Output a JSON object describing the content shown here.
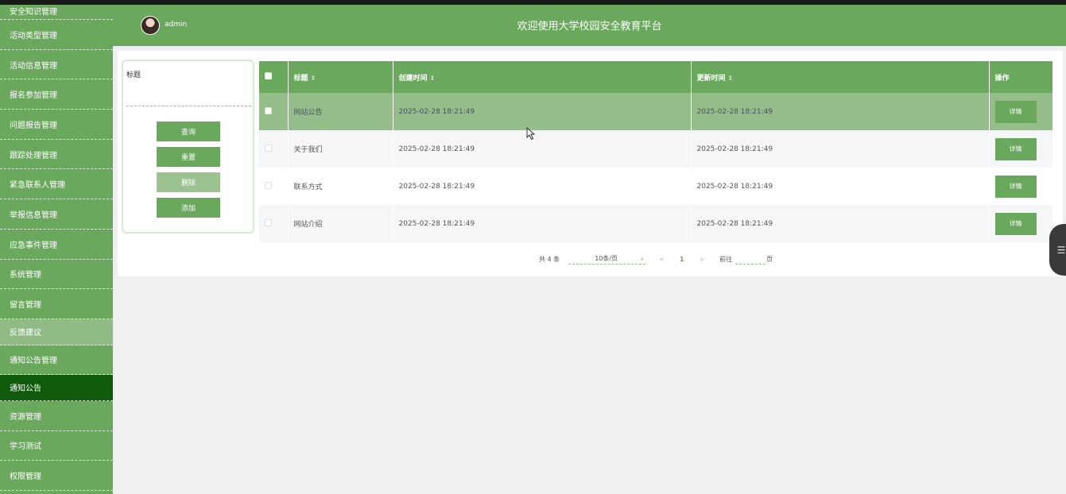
{
  "sidebar": {
    "items": [
      {
        "label": "安全知识管理",
        "state": "partial"
      },
      {
        "label": "活动类型管理",
        "state": ""
      },
      {
        "label": "活动信息管理",
        "state": ""
      },
      {
        "label": "报名参加管理",
        "state": ""
      },
      {
        "label": "问题报告管理",
        "state": ""
      },
      {
        "label": "跟踪处理管理",
        "state": ""
      },
      {
        "label": "紧急联系人管理",
        "state": ""
      },
      {
        "label": "举报信息管理",
        "state": ""
      },
      {
        "label": "应急事件管理",
        "state": ""
      },
      {
        "label": "系统管理",
        "state": ""
      },
      {
        "label": "留言管理",
        "state": ""
      },
      {
        "label": "反馈建议",
        "state": "hover"
      },
      {
        "label": "通知公告管理",
        "state": ""
      },
      {
        "label": "通知公告",
        "state": "active"
      },
      {
        "label": "资源管理",
        "state": ""
      },
      {
        "label": "学习测试",
        "state": ""
      },
      {
        "label": "权限管理",
        "state": ""
      }
    ]
  },
  "header": {
    "username": "admin",
    "title": "欢迎使用大学校园安全教育平台"
  },
  "search": {
    "title_label": "标题",
    "title_value": "",
    "query_label": "查询",
    "reset_label": "重置",
    "delete_label": "删除",
    "add_label": "添加"
  },
  "table": {
    "columns": [
      "标题",
      "创建时间",
      "更新时间",
      "操作"
    ],
    "sort_icon": "⇕",
    "rows": [
      {
        "title": "网站公告",
        "created": "2025-02-28 18:21:49",
        "updated": "2025-02-28 18:21:49",
        "action": "详情"
      },
      {
        "title": "关于我们",
        "created": "2025-02-28 18:21:49",
        "updated": "2025-02-28 18:21:49",
        "action": "详情"
      },
      {
        "title": "联系方式",
        "created": "2025-02-28 18:21:49",
        "updated": "2025-02-28 18:21:49",
        "action": "详情"
      },
      {
        "title": "网站介绍",
        "created": "2025-02-28 18:21:49",
        "updated": "2025-02-28 18:21:49",
        "action": "详情"
      }
    ]
  },
  "pagination": {
    "total": "共 4 条",
    "page_size": "10条/页",
    "prev": "<",
    "current": "1",
    "next": ">",
    "goto": "前往",
    "page_unit": "页"
  },
  "colors": {
    "primary": "#6aa85e",
    "active_nav": "#0f5a0b",
    "hover_row": "#95bd8a"
  },
  "icons": [
    "avatar-image",
    "sort-icon",
    "checkbox",
    "chevron-down-icon",
    "collapse-tab-icon",
    "mouse-cursor-icon"
  ]
}
